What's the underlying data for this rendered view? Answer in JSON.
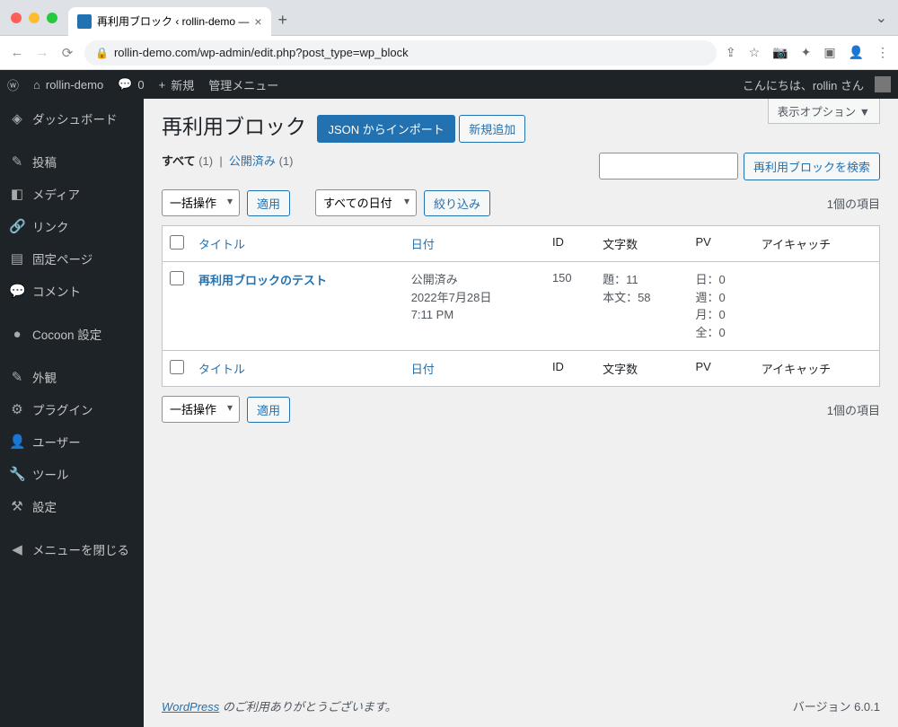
{
  "browser": {
    "tab_title": "再利用ブロック ‹ rollin-demo —",
    "url": "rollin-demo.com/wp-admin/edit.php?post_type=wp_block"
  },
  "admin_bar": {
    "site_name": "rollin-demo",
    "comments": "0",
    "new": "新規",
    "admin_menu": "管理メニュー",
    "greeting": "こんにちは、rollin さん"
  },
  "sidebar": {
    "items": [
      {
        "label": "ダッシュボード",
        "icon": "◈"
      },
      {
        "label": "投稿",
        "icon": "✎"
      },
      {
        "label": "メディア",
        "icon": "◧"
      },
      {
        "label": "リンク",
        "icon": "🔗"
      },
      {
        "label": "固定ページ",
        "icon": "▤"
      },
      {
        "label": "コメント",
        "icon": "💬"
      },
      {
        "label": "Cocoon 設定",
        "icon": "●"
      },
      {
        "label": "外観",
        "icon": "✎"
      },
      {
        "label": "プラグイン",
        "icon": "⚙"
      },
      {
        "label": "ユーザー",
        "icon": "👤"
      },
      {
        "label": "ツール",
        "icon": "🔧"
      },
      {
        "label": "設定",
        "icon": "⚒"
      },
      {
        "label": "メニューを閉じる",
        "icon": "◀"
      }
    ]
  },
  "page": {
    "screen_options": "表示オプション ▼",
    "title": "再利用ブロック",
    "btn_import": "JSON からインポート",
    "btn_new": "新規追加",
    "filter_all": "すべて",
    "filter_all_count": "(1)",
    "filter_published": "公開済み",
    "filter_published_count": "(1)",
    "search_btn": "再利用ブロックを検索",
    "bulk_action": "一括操作",
    "apply": "適用",
    "date_filter": "すべての日付",
    "filter_btn": "絞り込み",
    "count_label": "1個の項目"
  },
  "table": {
    "cols": {
      "title": "タイトル",
      "date": "日付",
      "id": "ID",
      "chars": "文字数",
      "pv": "PV",
      "eyecatch": "アイキャッチ"
    },
    "rows": [
      {
        "title": "再利用ブロックのテスト",
        "date_status": "公開済み",
        "date_date": "2022年7月28日",
        "date_time": "7:11 PM",
        "id": "150",
        "chars_title": "題：11",
        "chars_body": "本文：58",
        "pv_day": "日：0",
        "pv_week": "週：0",
        "pv_month": "月：0",
        "pv_all": "全：0"
      }
    ]
  },
  "footer": {
    "wp_link": "WordPress",
    "thanks": " のご利用ありがとうございます。",
    "version": "バージョン 6.0.1"
  }
}
